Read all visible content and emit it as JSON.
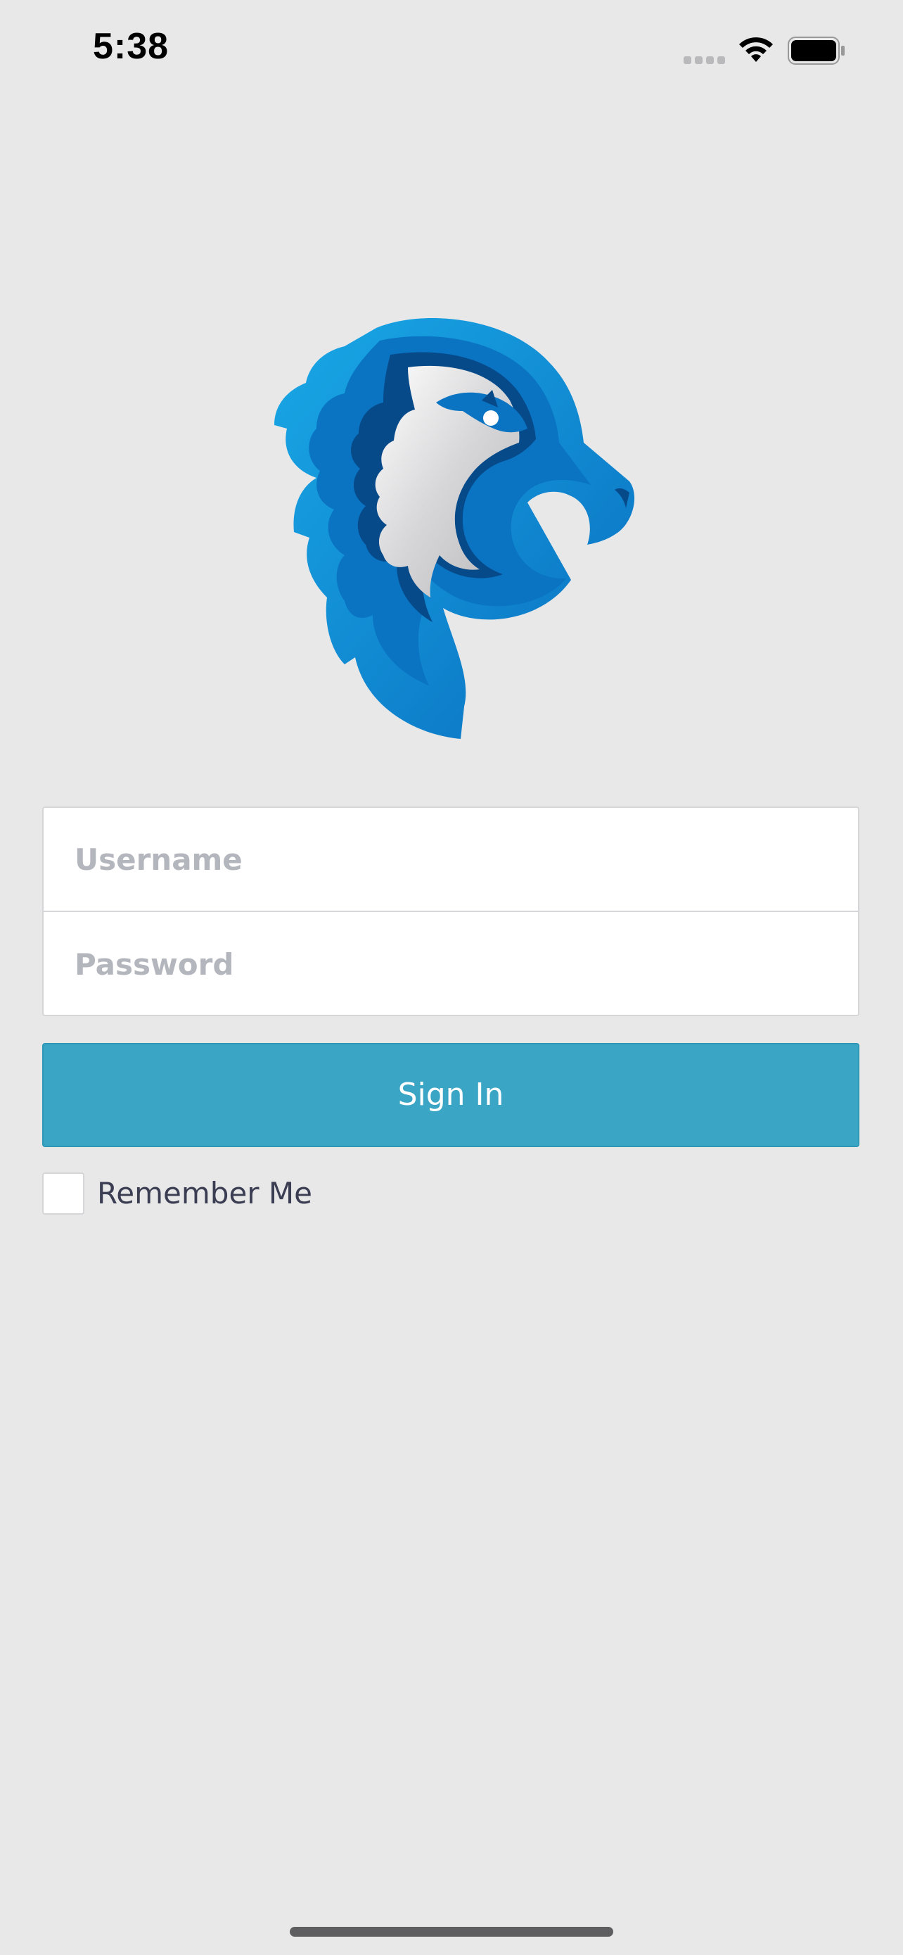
{
  "status_bar": {
    "time": "5:38"
  },
  "logo": {
    "icon": "eagle-head-logo",
    "colors": {
      "blue_light": "#19a3e2",
      "blue_mid": "#0a73c2",
      "blue_dark": "#074a8a",
      "silver": "#d4d4d6"
    }
  },
  "form": {
    "username": {
      "placeholder": "Username",
      "value": ""
    },
    "password": {
      "placeholder": "Password",
      "value": ""
    },
    "sign_in_label": "Sign In",
    "remember_me_label": "Remember Me",
    "remember_me_checked": false
  },
  "colors": {
    "background": "#e8e8e9",
    "accent": "#3aa5c4",
    "text": "#3b3e52"
  }
}
